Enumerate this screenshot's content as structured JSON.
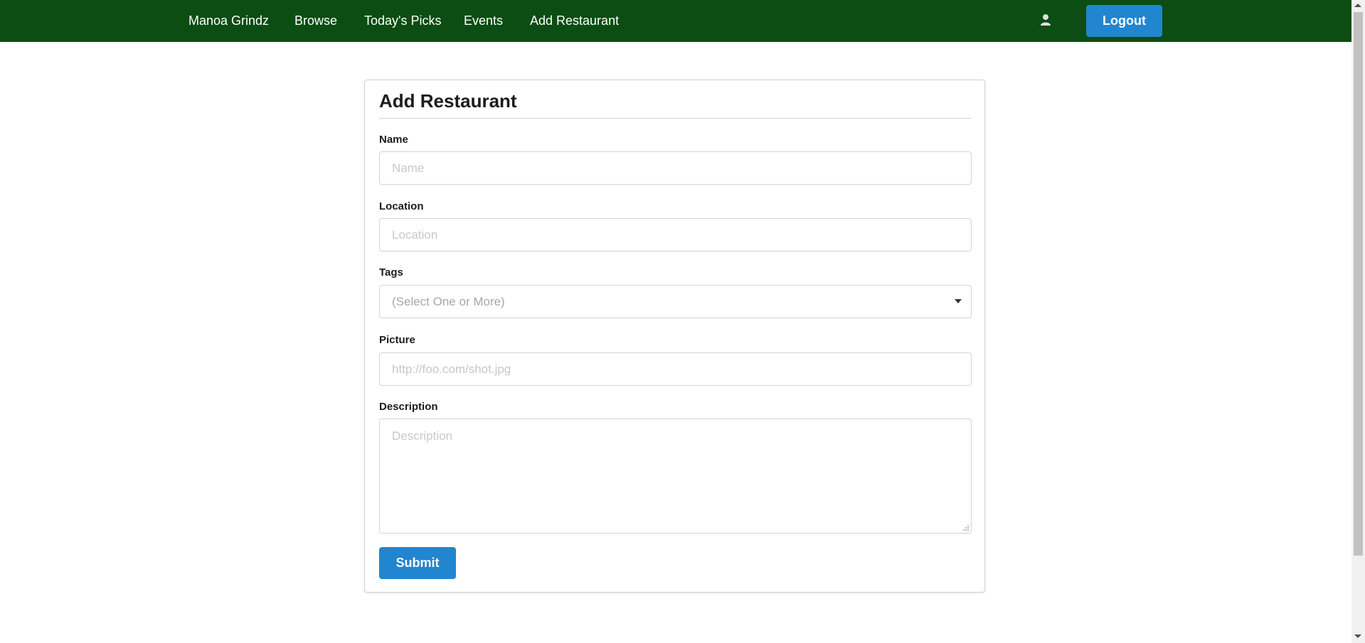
{
  "navbar": {
    "items": [
      {
        "label": "Manoa Grindz"
      },
      {
        "label": "Browse"
      },
      {
        "label": "Today's Picks"
      },
      {
        "label": "Events"
      },
      {
        "label": "Add Restaurant"
      }
    ],
    "user_icon": "user-icon",
    "logout_label": "Logout"
  },
  "form": {
    "title": "Add Restaurant",
    "fields": {
      "name": {
        "label": "Name",
        "placeholder": "Name",
        "value": ""
      },
      "location": {
        "label": "Location",
        "placeholder": "Location",
        "value": ""
      },
      "tags": {
        "label": "Tags",
        "placeholder": "(Select One or More)"
      },
      "picture": {
        "label": "Picture",
        "placeholder": "http://foo.com/shot.jpg",
        "value": ""
      },
      "description": {
        "label": "Description",
        "placeholder": "Description",
        "value": ""
      }
    },
    "submit_label": "Submit"
  },
  "colors": {
    "navbar_bg": "#0b4d12",
    "button_primary": "#2185d0",
    "border": "#d4d4d5",
    "placeholder": "#c8c8c8"
  }
}
